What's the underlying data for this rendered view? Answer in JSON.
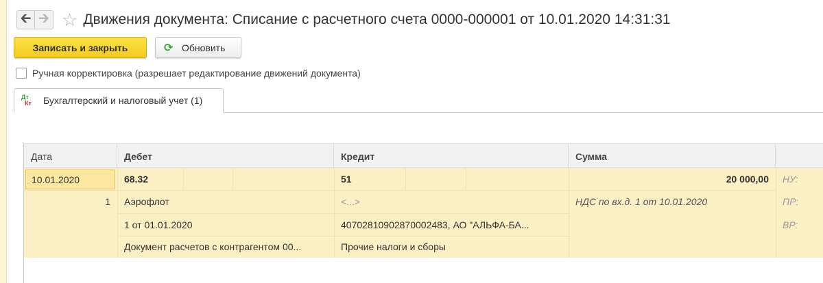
{
  "window": {
    "title": "Движения документа: Списание с расчетного счета 0000-000001 от 10.01.2020 14:31:31"
  },
  "toolbar": {
    "save_close_label": "Записать и закрыть",
    "refresh_label": "Обновить"
  },
  "manual_edit": {
    "label": "Ручная корректировка (разрешает редактирование движений документа)",
    "checked": false
  },
  "tabs": [
    {
      "label": "Бухгалтерский и налоговый учет (1)",
      "icon_top": "Дт",
      "icon_bottom": "Кт"
    }
  ],
  "table": {
    "columns": [
      "Дата",
      "Дебет",
      "Кредит",
      "Сумма"
    ],
    "row": {
      "date": "10.01.2020",
      "number": "1",
      "debit": {
        "account": "68.32",
        "subconto1": "Аэрофлот",
        "subconto2": "1 от 01.01.2020",
        "subconto3": "Документ расчетов с контрагентом 00..."
      },
      "credit": {
        "account": "51",
        "subconto1": "<...>",
        "subconto2": "40702810902870002483, АО \"АЛЬФА-БА...",
        "subconto3": "Прочие налоги и сборы"
      },
      "amount": "20 000,00",
      "content": "НДС по вх.д. 1 от 10.01.2020",
      "side_labels": [
        "НУ:",
        "ПР:",
        "ВР:"
      ]
    }
  },
  "colors": {
    "accent_yellow": "#f3cc1d",
    "row_highlight": "#fbefc4",
    "refresh_green": "#3fa535"
  }
}
